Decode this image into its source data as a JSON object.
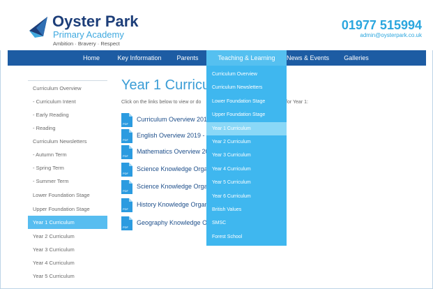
{
  "header": {
    "brand_title": "Oyster Park",
    "brand_subtitle": "Primary Academy",
    "brand_motto": "Ambition · Bravery · Respect",
    "phone": "01977 515994",
    "email": "admin@oysterpark.co.uk"
  },
  "nav": {
    "items": [
      {
        "label": "Home"
      },
      {
        "label": "Key Information"
      },
      {
        "label": "Parents"
      },
      {
        "label": "Teaching & Learning",
        "active": true
      },
      {
        "label": "News & Events"
      },
      {
        "label": "Galleries"
      }
    ]
  },
  "sidebar": {
    "items": [
      {
        "label": "Curriculum Overview"
      },
      {
        "label": "- Curriculum Intent"
      },
      {
        "label": "- Early Reading"
      },
      {
        "label": "- Reading"
      },
      {
        "label": "Curriculum Newsletters"
      },
      {
        "label": "- Autumn Term"
      },
      {
        "label": "- Spring Term"
      },
      {
        "label": "- Summer Term"
      },
      {
        "label": "Lower Foundation Stage"
      },
      {
        "label": "Upper Foundation Stage"
      },
      {
        "label": "Year 1 Curriculum",
        "active": true
      },
      {
        "label": "Year 2 Curriculum"
      },
      {
        "label": "Year 3 Curriculum"
      },
      {
        "label": "Year 4 Curriculum"
      },
      {
        "label": "Year 5 Curriculum"
      }
    ]
  },
  "main": {
    "title": "Year 1 Curricu",
    "intro": "Click on the links below to view or do",
    "intro_tail": "for Year 1:",
    "documents": [
      {
        "label": "Curriculum Overview 2019"
      },
      {
        "label": "English Overview 2019 - 2"
      },
      {
        "label": "Mathematics Overview 201"
      },
      {
        "label": "Science Knowledge Organi"
      },
      {
        "label": "Science Knowledge Organi"
      },
      {
        "label": "History Knowledge Organis"
      },
      {
        "label": "Geography Knowledge Org"
      }
    ]
  },
  "dropdown": {
    "items": [
      {
        "label": "Curriculum Overview"
      },
      {
        "label": "Curriculum Newsletters"
      },
      {
        "label": "Lower Foundation Stage"
      },
      {
        "label": "Upper Foundation Stage"
      },
      {
        "label": "Year 1 Curriculum",
        "active": true
      },
      {
        "label": "Year 2 Curriculum"
      },
      {
        "label": "Year 3 Curriculum"
      },
      {
        "label": "Year 4 Curriculum"
      },
      {
        "label": "Year 5 Curriculum"
      },
      {
        "label": "Year 6 Curriculum"
      },
      {
        "label": "British Values"
      },
      {
        "label": "SMSC"
      },
      {
        "label": "Forest School"
      }
    ]
  },
  "icons": {
    "document": "pdf-file-icon",
    "logo": "sailboat-logo-icon"
  },
  "colors": {
    "navy": "#1d3e79",
    "nav_bar": "#1d5ca3",
    "accent": "#3fb7ef",
    "active_highlight": "#57bdf0"
  }
}
